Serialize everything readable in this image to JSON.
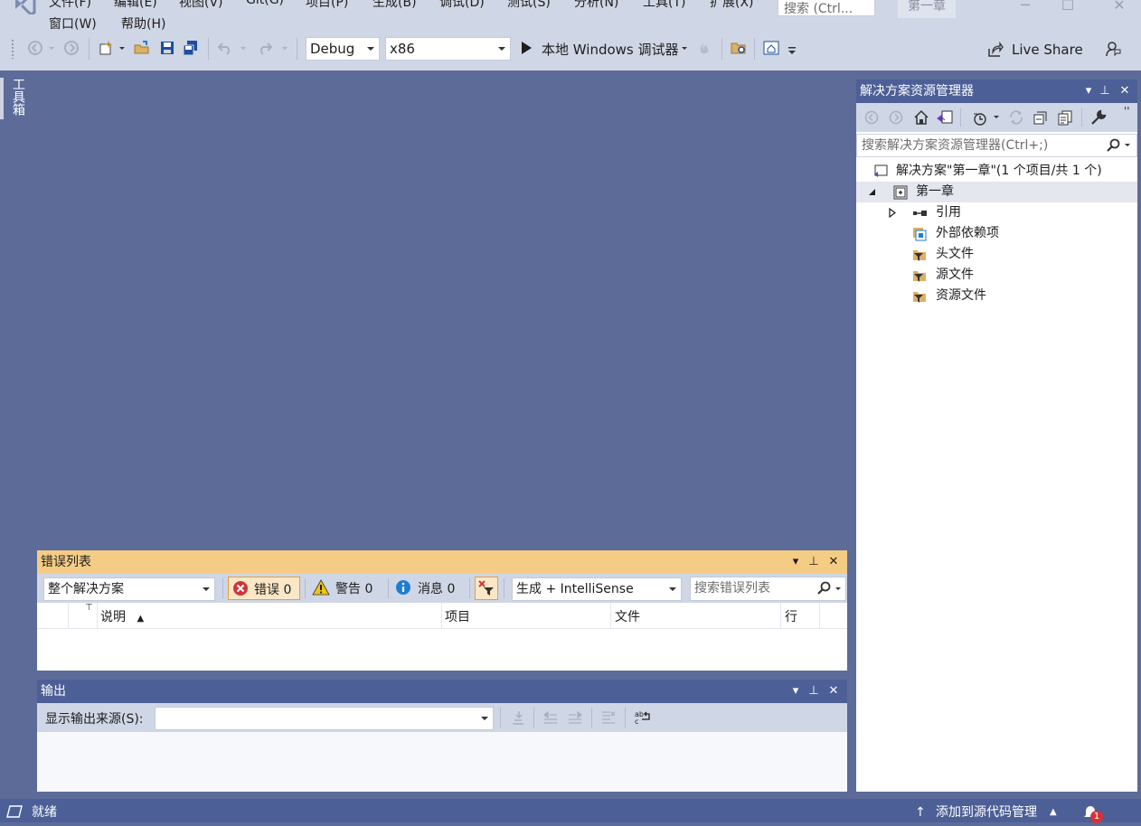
{
  "menu": {
    "row1": [
      "文件(F)",
      "编辑(E)",
      "视图(V)",
      "Git(G)",
      "项目(P)",
      "生成(B)",
      "调试(D)",
      "测试(S)",
      "分析(N)",
      "工具(T)",
      "扩展(X)"
    ],
    "row2": [
      "窗口(W)",
      "帮助(H)"
    ],
    "search_placeholder": "搜索 (Ctrl...",
    "solution_name": "第一章"
  },
  "toolbar": {
    "config": "Debug",
    "platform": "x86",
    "run_label": "本地 Windows 调试器",
    "live_share": "Live Share"
  },
  "toolbox": {
    "label": "工具箱"
  },
  "solution_explorer": {
    "title": "解决方案资源管理器",
    "search_placeholder": "搜索解决方案资源管理器(Ctrl+;)",
    "solution_label": "解决方案\"第一章\"(1 个项目/共 1 个)",
    "project_label": "第一章",
    "items": [
      "引用",
      "外部依赖项",
      "头文件",
      "源文件",
      "资源文件"
    ]
  },
  "error_list": {
    "title": "错误列表",
    "scope": "整个解决方案",
    "errors": "错误 0",
    "warnings": "警告 0",
    "messages": "消息 0",
    "build_filter": "生成 + IntelliSense",
    "search_placeholder": "搜索错误列表",
    "columns": [
      "说明",
      "项目",
      "文件",
      "行"
    ]
  },
  "output": {
    "title": "输出",
    "source_label": "显示输出来源(S):",
    "source_value": ""
  },
  "status": {
    "ready": "就绪",
    "source_control": "添加到源代码管理",
    "notification_count": "1"
  },
  "colors": {
    "background": "#5d6b99",
    "chrome": "#cfd6e5",
    "panel_title_active": "#f5cc84",
    "panel_title": "#4d5f97",
    "error_red": "#d13438",
    "warning_yellow": "#f2c511",
    "info_blue": "#1e7ed6"
  }
}
